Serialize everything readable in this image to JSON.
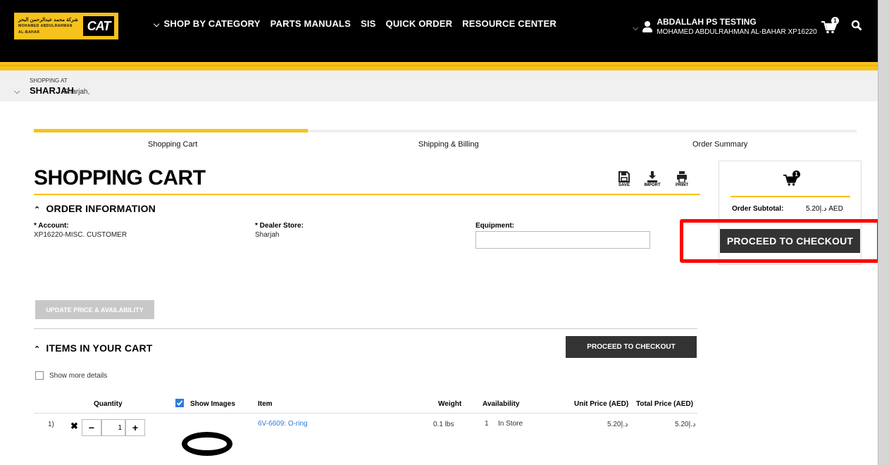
{
  "header": {
    "logo_arabic": "شركة محمد عبدالرحمن البحر",
    "logo_english": "MOHAMED ABDULRAHMAN AL-BAHAR",
    "logo_brand": "CAT",
    "nav": [
      "SHOP BY CATEGORY",
      "PARTS MANUALS",
      "SIS",
      "QUICK ORDER",
      "RESOURCE CENTER"
    ],
    "user_name": "ABDALLAH PS TESTING",
    "user_sub": "MOHAMED ABDULRAHMAN AL-BAHAR XP16220",
    "cart_count": "1"
  },
  "store": {
    "shopping_at": "SHOPPING AT",
    "name": "SHARJAH",
    "city": "Sharjah,"
  },
  "steps": [
    "Shopping Cart",
    "Shipping & Billing",
    "Order Summary"
  ],
  "progress": 0.333,
  "page_title": "SHOPPING CART",
  "tools": {
    "save": "SAVE",
    "import": "IMPORT",
    "print": "PRINT"
  },
  "order_info": {
    "heading": "ORDER INFORMATION",
    "account_label": "* Account:",
    "account_value": "XP16220-MISC. CUSTOMER",
    "dealer_label": "* Dealer Store:",
    "dealer_value": "Sharjah",
    "equipment_label": "Equipment:",
    "equipment_value": ""
  },
  "update_button": "UPDATE PRICE & AVAILABILITY",
  "items": {
    "heading": "ITEMS IN YOUR CART",
    "checkout_label": "PROCEED TO CHECKOUT",
    "show_more": "Show more details",
    "show_images": "Show Images",
    "columns": [
      "Quantity",
      "Item",
      "Weight",
      "Availability",
      "Unit Price (AED)",
      "Total Price (AED)"
    ],
    "rows": [
      {
        "index": "1)",
        "qty": "1",
        "item": "6V-6609: O-ring",
        "weight": "0.1 lbs",
        "avail_qty": "1",
        "avail_text": "In Store",
        "unit_price": "5.20د.إ",
        "total_price": "5.20د.إ"
      }
    ]
  },
  "summary": {
    "cart_count": "1",
    "subtotal_label": "Order Subtotal:",
    "subtotal_value": "5.20د.إ AED",
    "checkout_label": "PROCEED TO CHECKOUT"
  },
  "colors": {
    "brand_yellow": "#f7c21b",
    "dark_button": "#333333",
    "highlight": "#ff0000",
    "link": "#2e7ad6"
  }
}
